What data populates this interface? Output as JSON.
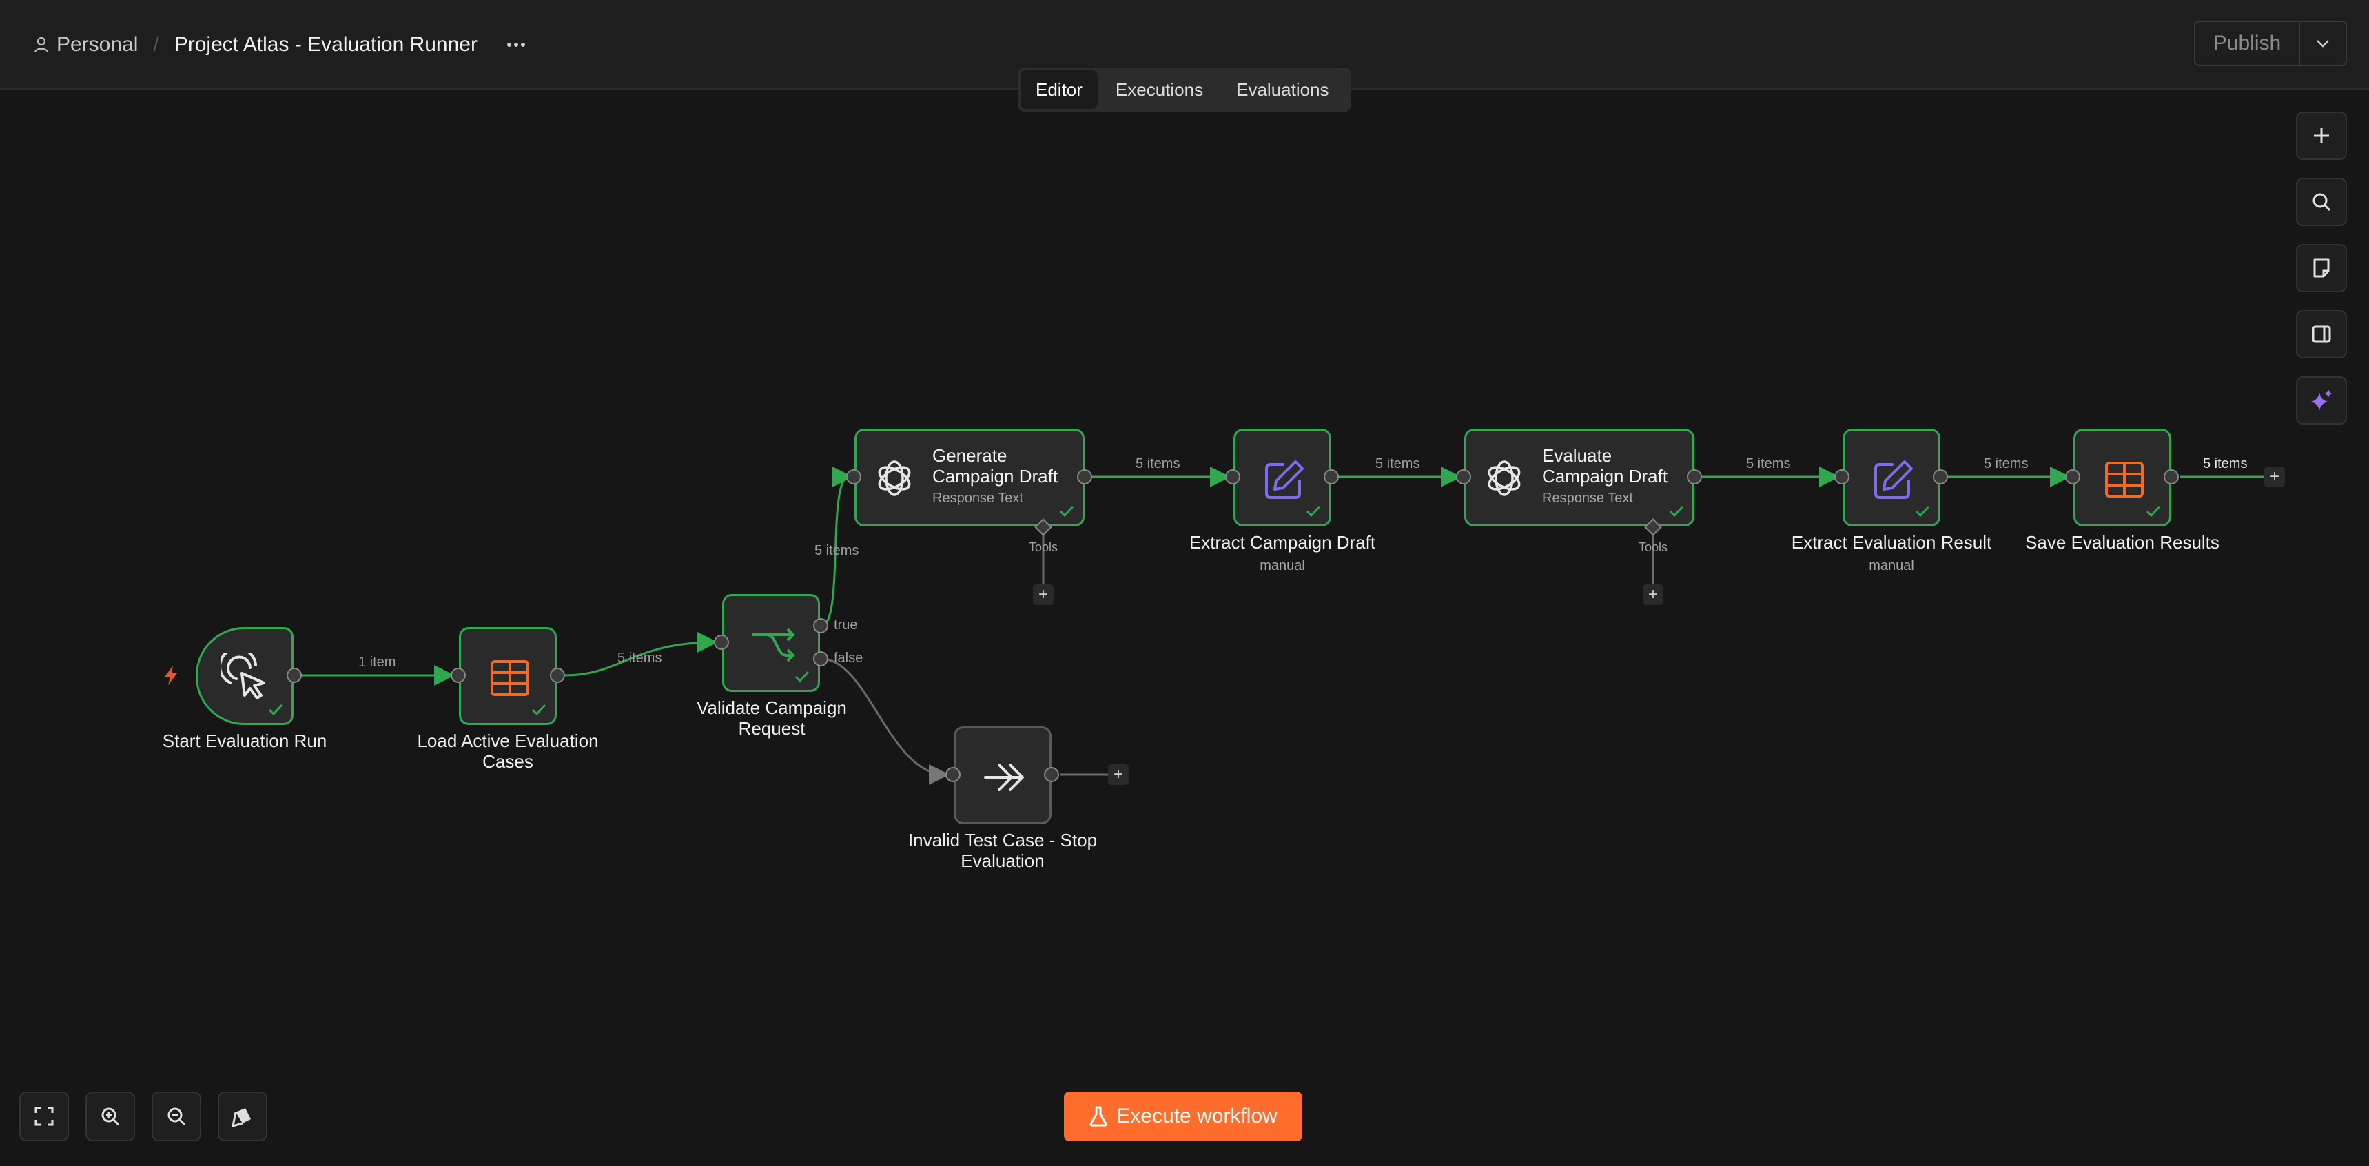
{
  "header": {
    "workspace": "Personal",
    "separator": "/",
    "workflow_title": "Project Atlas - Evaluation Runner",
    "more_label": "···",
    "publish_label": "Publish"
  },
  "tabs": [
    {
      "label": "Editor",
      "active": true
    },
    {
      "label": "Executions",
      "active": false
    },
    {
      "label": "Evaluations",
      "active": false
    }
  ],
  "nodes": {
    "start": {
      "label": "Start Evaluation Run",
      "icon": "cursor-click-icon"
    },
    "load": {
      "label_1": "Load Active Evaluation",
      "label_2": "Cases",
      "icon": "table-icon"
    },
    "validate": {
      "label_1": "Validate Campaign",
      "label_2": "Request",
      "icon": "if-branch-icon",
      "true_label": "true",
      "false_label": "false"
    },
    "generate": {
      "title_1": "Generate",
      "title_2": "Campaign Draft",
      "sub": "Response Text",
      "icon": "openai-icon",
      "tools_label": "Tools"
    },
    "extract_draft": {
      "label": "Extract Campaign Draft",
      "sub": "manual",
      "icon": "edit-icon"
    },
    "evaluate": {
      "title_1": "Evaluate",
      "title_2": "Campaign Draft",
      "sub": "Response Text",
      "icon": "openai-icon",
      "tools_label": "Tools"
    },
    "extract_result": {
      "label": "Extract Evaluation Result",
      "sub": "manual",
      "icon": "edit-icon"
    },
    "save": {
      "label": "Save Evaluation Results",
      "icon": "table-icon"
    },
    "invalid": {
      "label_1": "Invalid Test Case - Stop",
      "label_2": "Evaluation",
      "icon": "double-arrow-icon"
    }
  },
  "edges": {
    "start_load": "1 item",
    "load_validate": "5 items",
    "validate_generate": "5 items",
    "generate_extract": "5 items",
    "extract_evaluate": "5 items",
    "evaluate_extract": "5 items",
    "extract_save": "5 items",
    "save_out": "5 items"
  },
  "plus": "+",
  "execute_label": "Execute workflow",
  "colors": {
    "success_green": "#2fa84f",
    "accent_orange": "#ff6d2d",
    "table_orange": "#ee6b2a",
    "edit_purple": "#7b6cf0",
    "background": "#161616"
  },
  "toolbar_right": [
    "plus-icon",
    "search-icon",
    "sticky-note-icon",
    "panel-icon",
    "ai-sparkle-icon"
  ],
  "toolbar_bottom": [
    "fit-view-icon",
    "zoom-in-icon",
    "zoom-out-icon",
    "cleanup-icon"
  ]
}
